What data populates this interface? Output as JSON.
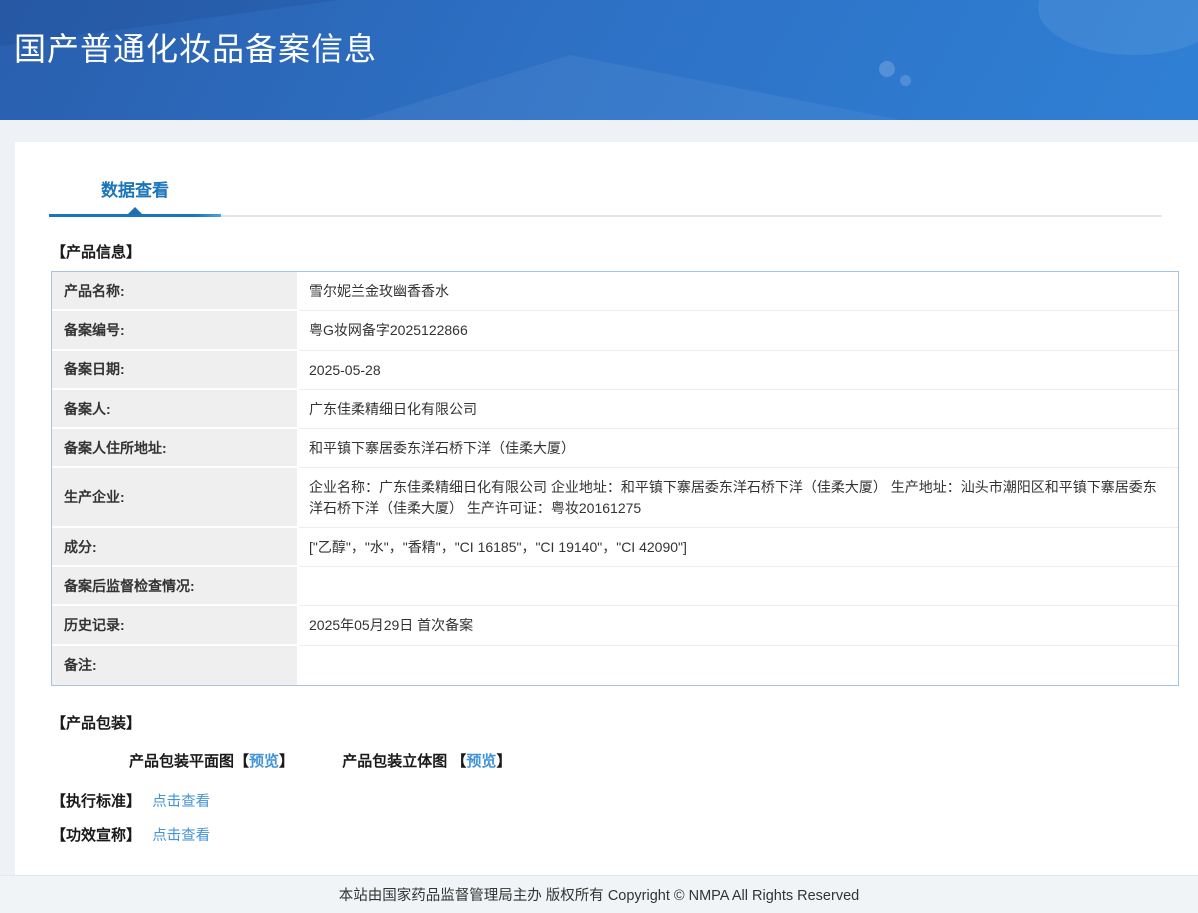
{
  "header": {
    "title": "国产普通化妆品备案信息"
  },
  "tabs": {
    "data_view": "数据查看"
  },
  "product_info": {
    "section_title": "【产品信息】",
    "rows": [
      {
        "label": "产品名称:",
        "value": "雪尔妮兰金玫幽香香水"
      },
      {
        "label": "备案编号:",
        "value": "粤G妆网备字2025122866"
      },
      {
        "label": "备案日期:",
        "value": "2025-05-28"
      },
      {
        "label": "备案人:",
        "value": "广东佳柔精细日化有限公司"
      },
      {
        "label": "备案人住所地址:",
        "value": "和平镇下寨居委东洋石桥下洋（佳柔大厦）"
      },
      {
        "label": "生产企业:",
        "value": "企业名称：广东佳柔精细日化有限公司 企业地址：和平镇下寨居委东洋石桥下洋（佳柔大厦） 生产地址：汕头市潮阳区和平镇下寨居委东洋石桥下洋（佳柔大厦） 生产许可证：粤妆20161275"
      },
      {
        "label": "成分:",
        "value": "[\"乙醇\"，\"水\"，\"香精\"，\"CI 16185\"，\"CI 19140\"，\"CI 42090\"]"
      },
      {
        "label": "备案后监督检查情况:",
        "value": ""
      },
      {
        "label": "历史记录:",
        "value": "2025年05月29日 首次备案"
      },
      {
        "label": "备注:",
        "value": ""
      }
    ]
  },
  "packaging": {
    "section_title": "【产品包装】",
    "flat_label": "产品包装平面图",
    "stereo_label": "产品包装立体图 ",
    "bracket_open": "【",
    "bracket_close": "】",
    "preview_link": "预览"
  },
  "standards": {
    "section_title": "【执行标准】",
    "link": "点击查看"
  },
  "efficacy": {
    "section_title": "【功效宣称】",
    "link": "点击查看"
  },
  "footer": {
    "text": "本站由国家药品监督管理局主办 版权所有 Copyright © NMPA All Rights Reserved"
  },
  "colors": {
    "accent_blue": "#1b75bb",
    "link_blue": "#4393d9",
    "banner_gradient_start": "#2a5fae",
    "banner_gradient_end": "#2f80d5",
    "label_cell_bg": "#efefef",
    "table_border": "#a4c3e6",
    "page_bg": "#eef1f5",
    "footer_bg": "#f1f4f6"
  }
}
